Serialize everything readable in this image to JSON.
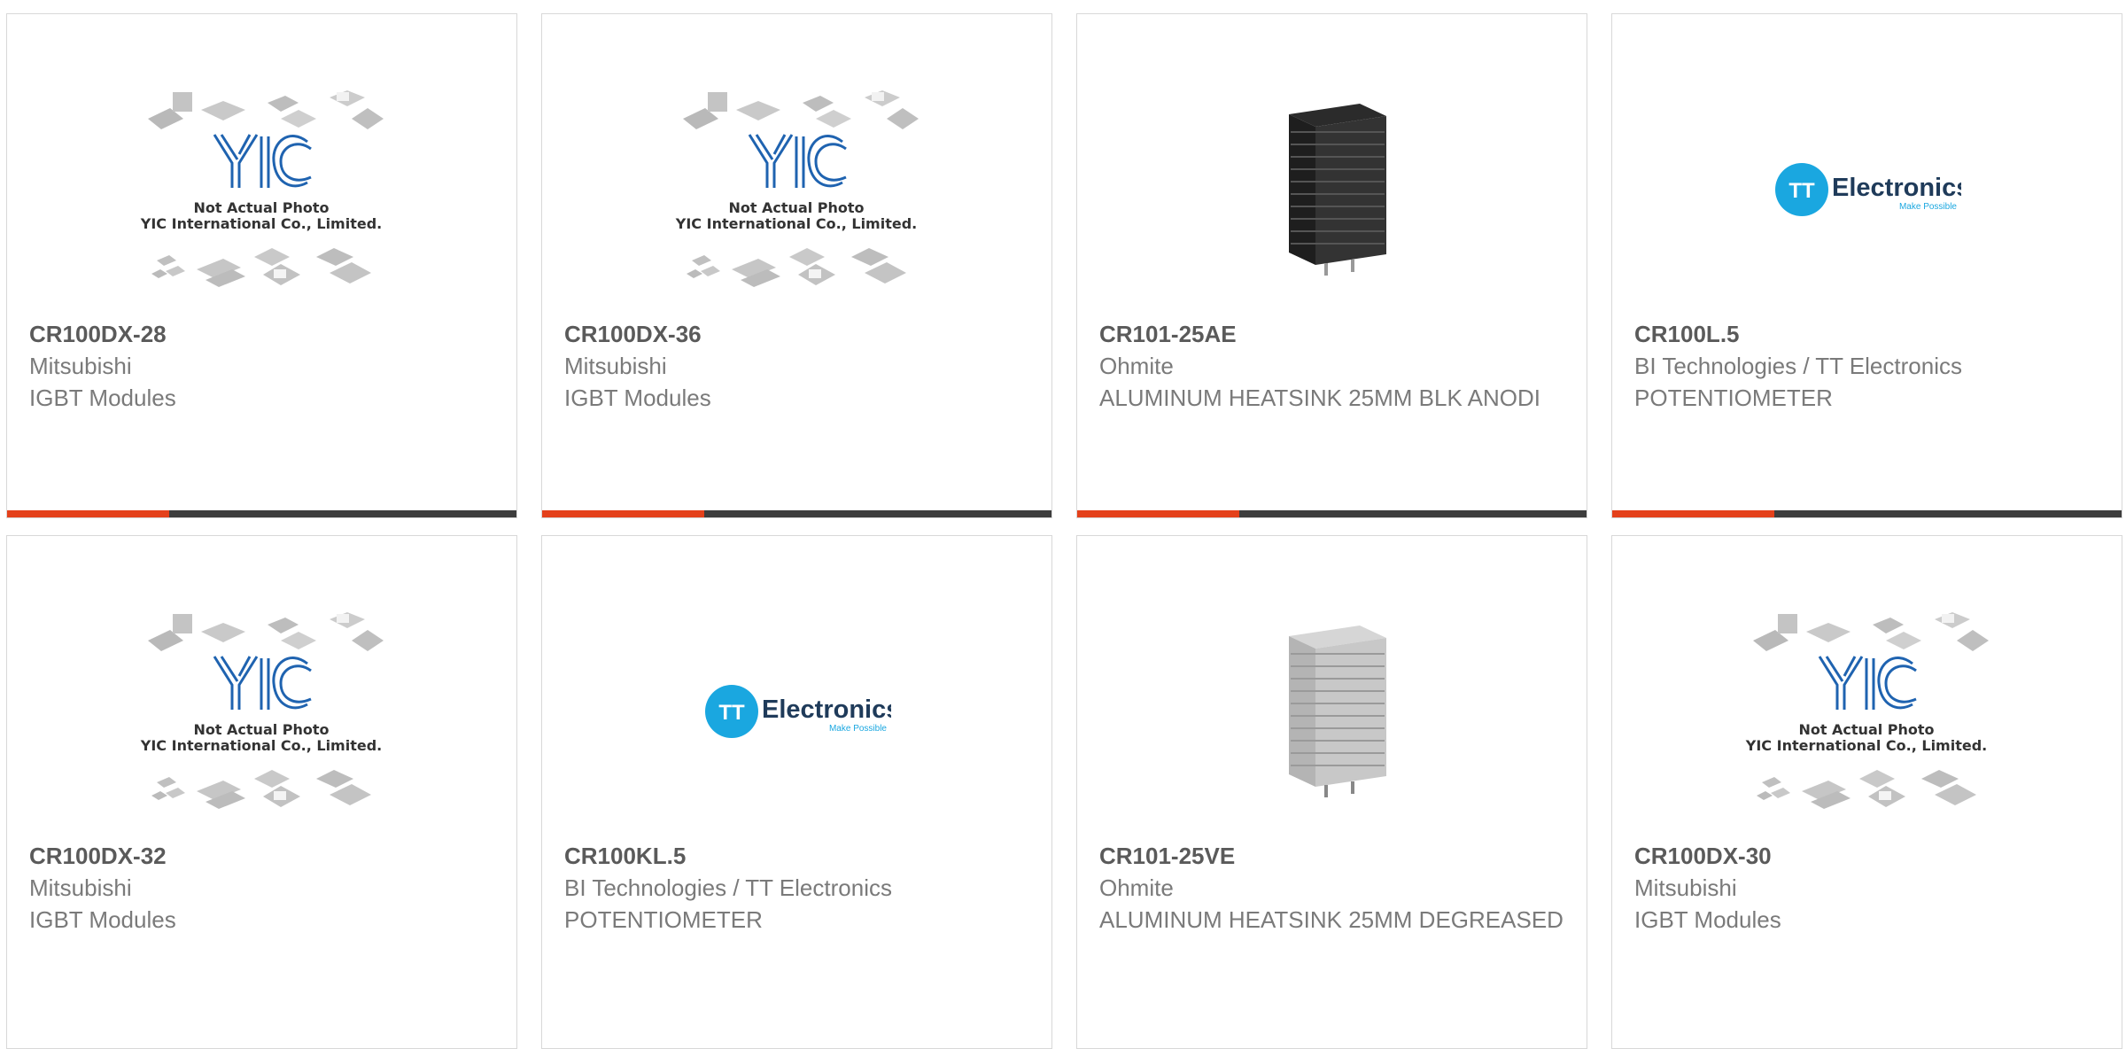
{
  "colors": {
    "accent": "#e4411b",
    "bar": "#3d3d3d",
    "yic_blue": "#1f63b0",
    "tt_blue": "#1aa7e0"
  },
  "placeholder": {
    "line1": "Not Actual Photo",
    "line2": "YIC International Co., Limited."
  },
  "tt_logo": {
    "mark": "TT",
    "word": "Electronics",
    "tag": "Make Possible"
  },
  "products": [
    {
      "part": "CR100DX-28",
      "manufacturer": "Mitsubishi",
      "description": "IGBT Modules",
      "image": "yic-placeholder"
    },
    {
      "part": "CR100DX-36",
      "manufacturer": "Mitsubishi",
      "description": "IGBT Modules",
      "image": "yic-placeholder"
    },
    {
      "part": "CR101-25AE",
      "manufacturer": "Ohmite",
      "description": "ALUMINUM HEATSINK 25MM BLK ANODI",
      "image": "black-heatsink"
    },
    {
      "part": "CR100L.5",
      "manufacturer": "BI Technologies / TT Electronics",
      "description": "POTENTIOMETER",
      "image": "tt-electronics-logo"
    },
    {
      "part": "CR100DX-32",
      "manufacturer": "Mitsubishi",
      "description": "IGBT Modules",
      "image": "yic-placeholder"
    },
    {
      "part": "CR100KL.5",
      "manufacturer": "BI Technologies / TT Electronics",
      "description": "POTENTIOMETER",
      "image": "tt-electronics-logo"
    },
    {
      "part": "CR101-25VE",
      "manufacturer": "Ohmite",
      "description": "ALUMINUM HEATSINK 25MM DEGREASED",
      "image": "silver-heatsink"
    },
    {
      "part": "CR100DX-30",
      "manufacturer": "Mitsubishi",
      "description": "IGBT Modules",
      "image": "yic-placeholder"
    }
  ]
}
